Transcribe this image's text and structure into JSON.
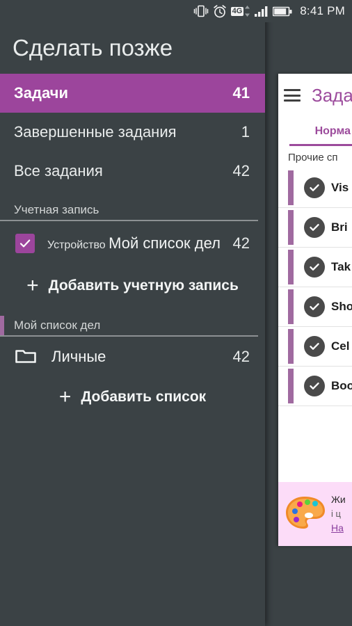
{
  "status_bar": {
    "icons": [
      "vibrate-icon",
      "alarm-icon",
      "4g-badge",
      "data-transfer-icon",
      "signal-icon",
      "battery-icon"
    ],
    "network_label": "4G",
    "time": "8:41 PM"
  },
  "drawer": {
    "title": "Сделать позже",
    "nav_items": [
      {
        "label": "Задачи",
        "count": "41",
        "selected": true
      },
      {
        "label": "Завершенные задания",
        "count": "1",
        "selected": false
      },
      {
        "label": "Все задания",
        "count": "42",
        "selected": false
      }
    ],
    "account_section": {
      "header": "Учетная запись",
      "checkbox_checked": true,
      "sub_label": "Устройство",
      "name": "Мой список дел",
      "count": "42",
      "add_label": "Добавить учетную запись",
      "add_icon": "plus-icon"
    },
    "lists_section": {
      "header": "Мой список дел",
      "items": [
        {
          "icon": "folder-icon",
          "label": "Личные",
          "count": "42"
        }
      ],
      "add_label": "Добавить список",
      "add_icon": "plus-icon"
    }
  },
  "main_panel": {
    "menu_icon": "hamburger-icon",
    "title": "Зада",
    "tab_label": "Норма",
    "section_label": "Прочие сп",
    "tasks": [
      {
        "title": "Vis",
        "checked": true
      },
      {
        "title": "Bri",
        "checked": true
      },
      {
        "title": "Tak",
        "checked": true
      },
      {
        "title": "Sho",
        "checked": true
      },
      {
        "title": "Cel",
        "checked": true
      },
      {
        "title": "Boo",
        "checked": true
      }
    ],
    "promo": {
      "icon": "palette-icon",
      "line1": "Жи",
      "line2": "і ц",
      "link": "На"
    }
  },
  "colors": {
    "drawer_bg": "#3b4245",
    "accent_purple": "#9c459c",
    "accent_purple_light": "#a06aa0",
    "promo_bg": "#fcdcf8",
    "text_primary": "#f2f4f4"
  }
}
